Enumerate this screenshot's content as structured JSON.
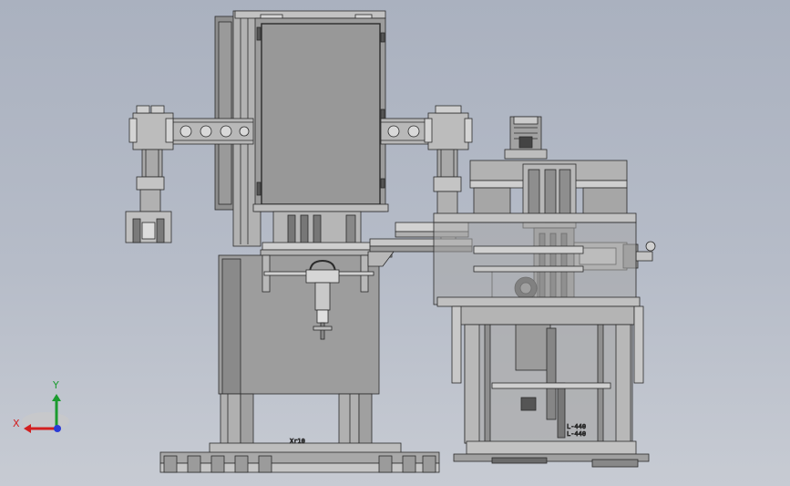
{
  "viewport": {
    "background_top": "#aab1bf",
    "background_bottom": "#c7cbd3"
  },
  "colors": {
    "frame": "#a7a7a7",
    "frame_light": "#c4c4c4",
    "frame_dark": "#7d7d7d",
    "outline": "#2b2b2b",
    "panel": "#989898",
    "axis_x": "#d21f1f",
    "axis_y": "#1b9b2f",
    "axis_z": "#2a3bd6"
  },
  "labels": {
    "base_tag": "Xr10",
    "tag_a": "L-440",
    "tag_b": "L-440"
  },
  "triad": {
    "x_label": "X",
    "y_label": "Y"
  }
}
